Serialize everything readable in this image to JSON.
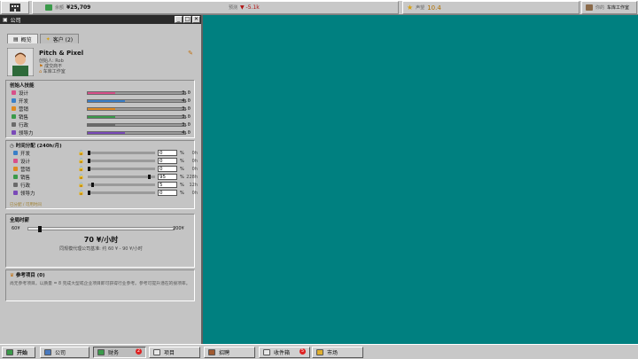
{
  "topbar": {
    "money_label": "余额",
    "money": "¥25,709",
    "forecast_label": "预测",
    "forecast": "▼ -5.1k",
    "rep_label": "声望",
    "rep": "10.4",
    "studio_label": "你的",
    "studio": "车库工作室"
  },
  "window": {
    "title": "公司",
    "buttons": [
      "_",
      "□",
      "✕"
    ]
  },
  "tabs": [
    {
      "label": "概览"
    },
    {
      "label": "客户 (2)"
    }
  ],
  "company": {
    "name": "Pitch & Pixel",
    "founder": "创始人: Rob",
    "line1": "成交商不",
    "line2": "车库工作室"
  },
  "skills": {
    "title": "创始人技能",
    "items": [
      {
        "label": "设计",
        "value": "3.0",
        "level": 0.28,
        "color": "#d8508a",
        "icon": "palette"
      },
      {
        "label": "开发",
        "value": "4.0",
        "level": 0.38,
        "color": "#3a7fc8",
        "icon": "code"
      },
      {
        "label": "营销",
        "value": "3.0",
        "level": 0.28,
        "color": "#e08a20",
        "icon": "megaphone"
      },
      {
        "label": "销售",
        "value": "3.0",
        "level": 0.28,
        "color": "#3a9a4a",
        "icon": "handshake"
      },
      {
        "label": "行政",
        "value": "3.0",
        "level": 0.28,
        "color": "#6a6a6a",
        "icon": "folder"
      },
      {
        "label": "领导力",
        "value": "4.0",
        "level": 0.38,
        "color": "#7a4ab8",
        "icon": "star"
      }
    ]
  },
  "allocation": {
    "title": "时间分配 (240h/月)",
    "footer": "已分配 / 可用时间",
    "items": [
      {
        "label": "开发",
        "value": "0",
        "hours": "0h",
        "level": 0.0,
        "lock": "🔓"
      },
      {
        "label": "设计",
        "value": "0",
        "hours": "0h",
        "level": 0.0,
        "lock": "🔓"
      },
      {
        "label": "营销",
        "value": "0",
        "hours": "0h",
        "level": 0.0,
        "lock": "🔓"
      },
      {
        "label": "销售",
        "value": "95",
        "hours": "228h",
        "level": 0.95,
        "lock": "🔓"
      },
      {
        "label": "行政",
        "value": "5",
        "hours": "12h",
        "level": 0.05,
        "lock": "🔒"
      },
      {
        "label": "领导力",
        "value": "0",
        "hours": "0h",
        "level": 0.0,
        "lock": "🔓"
      }
    ],
    "pct": "%"
  },
  "rate": {
    "title": "全局时薪",
    "min": "60¥",
    "max": "200¥",
    "value": "70 ¥/小时",
    "note": "同规模代理公司基准: 约 60 ¥ - 90 ¥/小时",
    "level": 0.07
  },
  "references": {
    "title": "参考项目 (0)",
    "text": "尚无参考项目。以质量 = 8 完成大型或企业项目即可获得行业参考。参考可提升潜在的接项率。"
  },
  "taskbar": [
    {
      "label": "开始",
      "color": "#3a9a4a",
      "badge": ""
    },
    {
      "label": "公司",
      "color": "#4a7abf",
      "badge": ""
    },
    {
      "label": "财务",
      "color": "#3a9a4a",
      "badge": "2"
    },
    {
      "label": "项目",
      "color": "#e8e8e8",
      "badge": ""
    },
    {
      "label": "招聘",
      "color": "#a05a30",
      "badge": ""
    },
    {
      "label": "收件箱",
      "color": "#e8e8e8",
      "badge": "5"
    },
    {
      "label": "市场",
      "color": "#e0b030",
      "badge": ""
    }
  ]
}
